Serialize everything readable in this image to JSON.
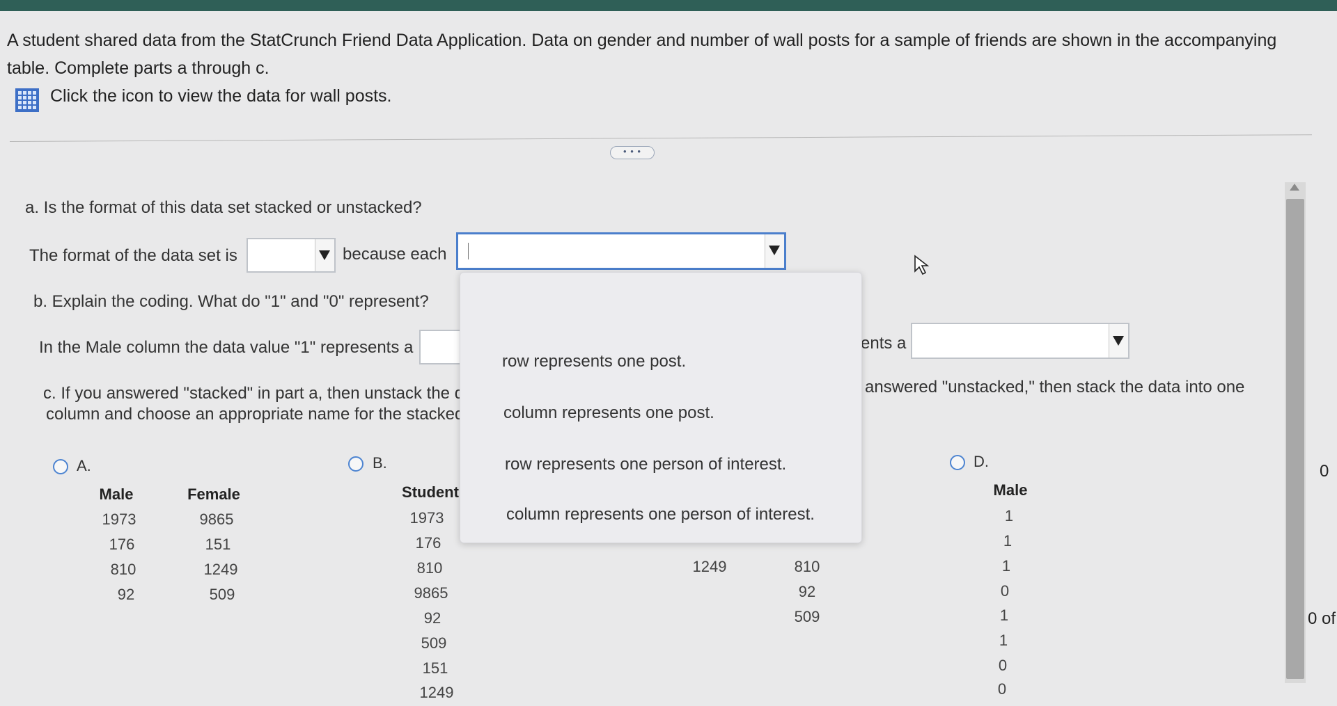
{
  "intro": {
    "line1": "A student shared data from the StatCrunch Friend Data Application. Data on gender and number of wall posts for a sample of friends are shown in the accompanying",
    "line2": "table. Complete parts a through c.",
    "data_link": "Click the icon to view the data for wall posts."
  },
  "more_button": "• • •",
  "part_a": {
    "question": "a. Is the format of this data set stacked or unstacked?",
    "sentence_start": "The format of the data set is",
    "because": "because each"
  },
  "part_b": {
    "question": "b. Explain the coding. What do \"1\" and \"0\" represent?",
    "sentence": "In the Male column the data value \"1\" represents a",
    "partial_right": "ents a"
  },
  "part_c": {
    "line1": "c. If you answered \"stacked\" in part a, then unstack the d",
    "line2": "column and choose an appropriate name for the stacked",
    "right": "answered \"unstacked,\" then stack the data into one"
  },
  "dropdown_options": [
    "row represents one post.",
    "column represents one post.",
    "row represents one person of interest.",
    "column represents one person of interest."
  ],
  "options": {
    "A": {
      "label": "A.",
      "headers": [
        "Male",
        "Female"
      ],
      "col1": [
        "1973",
        "176",
        "810",
        "92"
      ],
      "col2": [
        "9865",
        "151",
        "1249",
        "509"
      ]
    },
    "B": {
      "label": "B.",
      "header": "Student",
      "col": [
        "1973",
        "176",
        "810",
        "9865",
        "92",
        "509",
        "151",
        "1249"
      ],
      "hidden_col1": [
        "1249"
      ],
      "hidden_col2": [
        "810",
        "92",
        "509"
      ]
    },
    "D": {
      "label": "D.",
      "header": "Male",
      "col": [
        "1",
        "1",
        "1",
        "0",
        "1",
        "1",
        "0",
        "0"
      ]
    }
  },
  "edge_text": {
    "top": "0",
    "bottom": "0 of"
  },
  "colors": {
    "topbar": "#2f5f57",
    "accent": "#4b7fcc",
    "background": "#e9e9ea"
  }
}
